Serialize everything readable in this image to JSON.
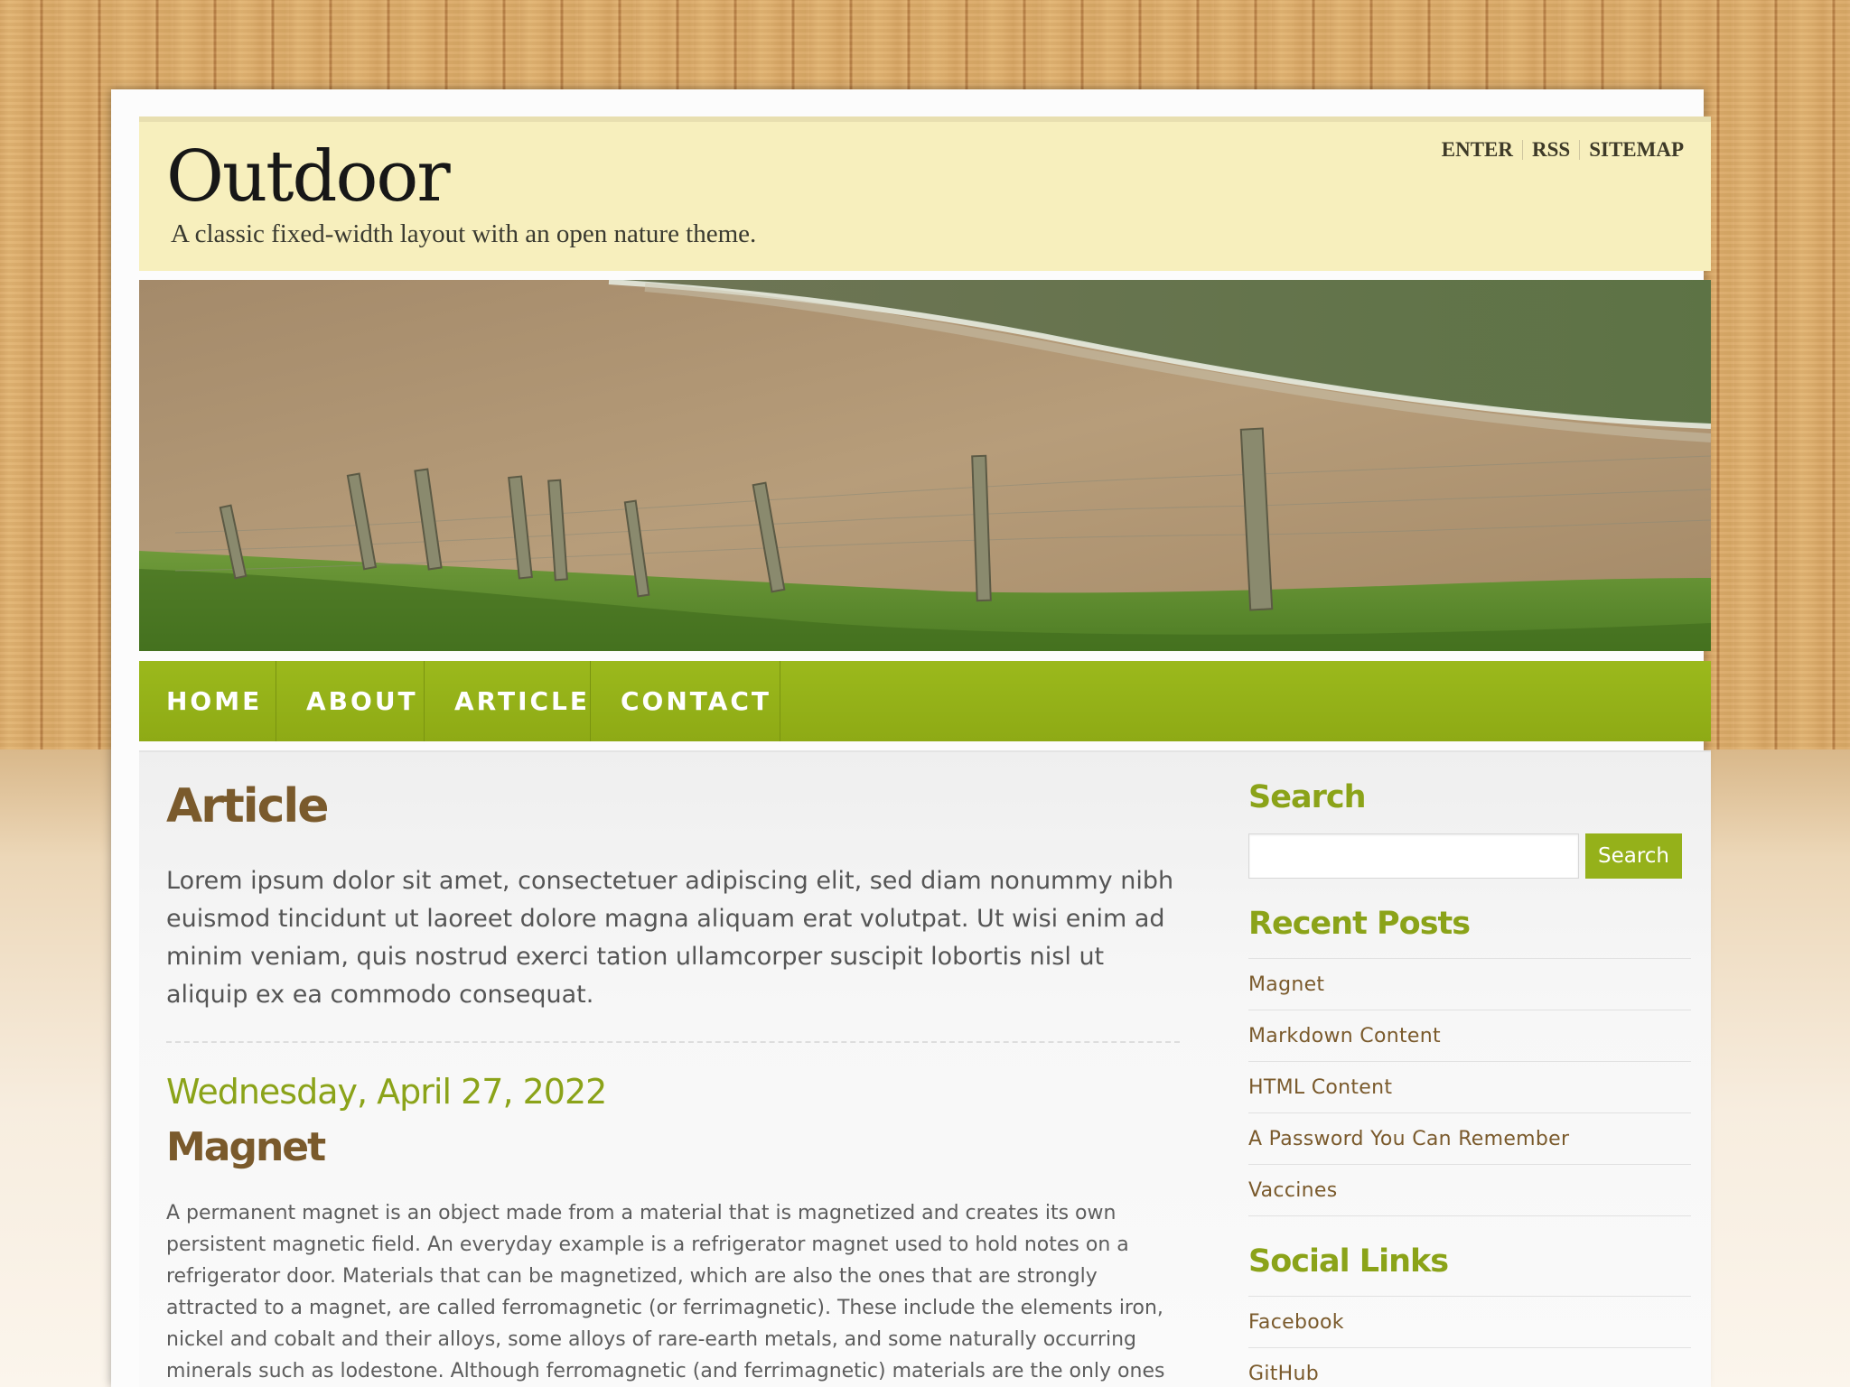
{
  "site": {
    "title": "Outdoor",
    "tagline": "A classic fixed-width layout with an open nature theme."
  },
  "top_links": [
    "ENTER",
    "RSS",
    "SITEMAP"
  ],
  "nav": [
    "HOME",
    "ABOUT",
    "ARTICLE",
    "CONTACT"
  ],
  "main": {
    "page_title": "Article",
    "intro": "Lorem ipsum dolor sit amet, consectetuer adipiscing elit, sed diam nonummy nibh euismod tincidunt ut laoreet dolore magna aliquam erat volutpat. Ut wisi enim ad minim veniam, quis nostrud exerci tation ullamcorper suscipit lobortis nisl ut aliquip ex ea commodo consequat.",
    "post_date": "Wednesday, April 27, 2022",
    "post_title": "Magnet",
    "post_body": "A permanent magnet is an object made from a material that is magnetized and creates its own persistent magnetic field. An everyday example is a refrigerator magnet used to hold notes on a refrigerator door. Materials that can be magnetized, which are also the ones that are strongly attracted to a magnet, are called ferromagnetic (or ferrimagnetic). These include the elements iron, nickel and cobalt and their alloys, some alloys of rare-earth metals, and some naturally occurring minerals such as lodestone. Although ferromagnetic (and ferrimagnetic) materials are the only ones"
  },
  "sidebar": {
    "search": {
      "title": "Search",
      "input_value": "",
      "button_label": "Search"
    },
    "recent_posts": {
      "title": "Recent Posts",
      "items": [
        "Magnet",
        "Markdown Content",
        "HTML Content",
        "A Password You Can Remember",
        "Vaccines"
      ]
    },
    "social": {
      "title": "Social Links",
      "items": [
        "Facebook",
        "GitHub"
      ]
    }
  },
  "colors": {
    "accent_green": "#95b11a",
    "brown": "#7a5a2c",
    "header_bg": "#f7efbd"
  }
}
